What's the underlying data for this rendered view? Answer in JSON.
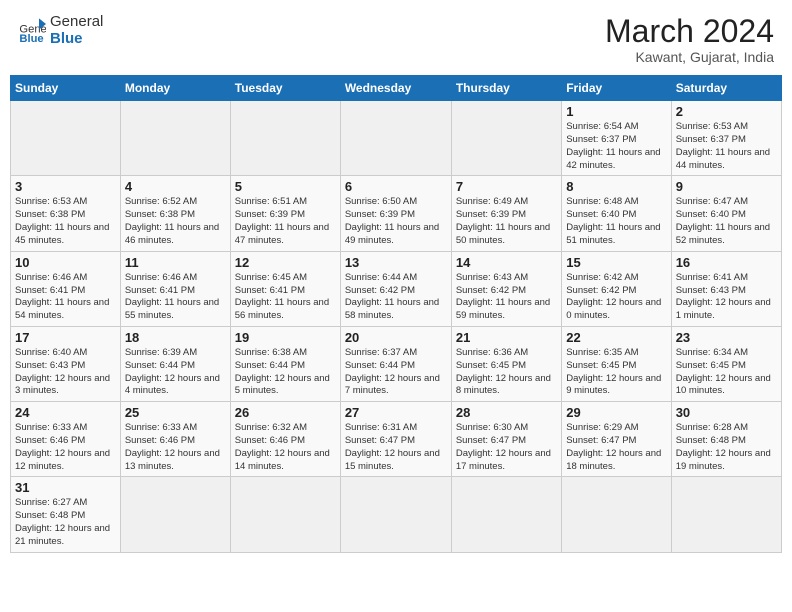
{
  "header": {
    "logo_text_general": "General",
    "logo_text_blue": "Blue",
    "month_title": "March 2024",
    "subtitle": "Kawant, Gujarat, India"
  },
  "weekdays": [
    "Sunday",
    "Monday",
    "Tuesday",
    "Wednesday",
    "Thursday",
    "Friday",
    "Saturday"
  ],
  "weeks": [
    [
      {
        "day": "",
        "info": ""
      },
      {
        "day": "",
        "info": ""
      },
      {
        "day": "",
        "info": ""
      },
      {
        "day": "",
        "info": ""
      },
      {
        "day": "",
        "info": ""
      },
      {
        "day": "1",
        "info": "Sunrise: 6:54 AM\nSunset: 6:37 PM\nDaylight: 11 hours\nand 42 minutes."
      },
      {
        "day": "2",
        "info": "Sunrise: 6:53 AM\nSunset: 6:37 PM\nDaylight: 11 hours\nand 44 minutes."
      }
    ],
    [
      {
        "day": "3",
        "info": "Sunrise: 6:53 AM\nSunset: 6:38 PM\nDaylight: 11 hours\nand 45 minutes."
      },
      {
        "day": "4",
        "info": "Sunrise: 6:52 AM\nSunset: 6:38 PM\nDaylight: 11 hours\nand 46 minutes."
      },
      {
        "day": "5",
        "info": "Sunrise: 6:51 AM\nSunset: 6:39 PM\nDaylight: 11 hours\nand 47 minutes."
      },
      {
        "day": "6",
        "info": "Sunrise: 6:50 AM\nSunset: 6:39 PM\nDaylight: 11 hours\nand 49 minutes."
      },
      {
        "day": "7",
        "info": "Sunrise: 6:49 AM\nSunset: 6:39 PM\nDaylight: 11 hours\nand 50 minutes."
      },
      {
        "day": "8",
        "info": "Sunrise: 6:48 AM\nSunset: 6:40 PM\nDaylight: 11 hours\nand 51 minutes."
      },
      {
        "day": "9",
        "info": "Sunrise: 6:47 AM\nSunset: 6:40 PM\nDaylight: 11 hours\nand 52 minutes."
      }
    ],
    [
      {
        "day": "10",
        "info": "Sunrise: 6:46 AM\nSunset: 6:41 PM\nDaylight: 11 hours\nand 54 minutes."
      },
      {
        "day": "11",
        "info": "Sunrise: 6:46 AM\nSunset: 6:41 PM\nDaylight: 11 hours\nand 55 minutes."
      },
      {
        "day": "12",
        "info": "Sunrise: 6:45 AM\nSunset: 6:41 PM\nDaylight: 11 hours\nand 56 minutes."
      },
      {
        "day": "13",
        "info": "Sunrise: 6:44 AM\nSunset: 6:42 PM\nDaylight: 11 hours\nand 58 minutes."
      },
      {
        "day": "14",
        "info": "Sunrise: 6:43 AM\nSunset: 6:42 PM\nDaylight: 11 hours\nand 59 minutes."
      },
      {
        "day": "15",
        "info": "Sunrise: 6:42 AM\nSunset: 6:42 PM\nDaylight: 12 hours\nand 0 minutes."
      },
      {
        "day": "16",
        "info": "Sunrise: 6:41 AM\nSunset: 6:43 PM\nDaylight: 12 hours\nand 1 minute."
      }
    ],
    [
      {
        "day": "17",
        "info": "Sunrise: 6:40 AM\nSunset: 6:43 PM\nDaylight: 12 hours\nand 3 minutes."
      },
      {
        "day": "18",
        "info": "Sunrise: 6:39 AM\nSunset: 6:44 PM\nDaylight: 12 hours\nand 4 minutes."
      },
      {
        "day": "19",
        "info": "Sunrise: 6:38 AM\nSunset: 6:44 PM\nDaylight: 12 hours\nand 5 minutes."
      },
      {
        "day": "20",
        "info": "Sunrise: 6:37 AM\nSunset: 6:44 PM\nDaylight: 12 hours\nand 7 minutes."
      },
      {
        "day": "21",
        "info": "Sunrise: 6:36 AM\nSunset: 6:45 PM\nDaylight: 12 hours\nand 8 minutes."
      },
      {
        "day": "22",
        "info": "Sunrise: 6:35 AM\nSunset: 6:45 PM\nDaylight: 12 hours\nand 9 minutes."
      },
      {
        "day": "23",
        "info": "Sunrise: 6:34 AM\nSunset: 6:45 PM\nDaylight: 12 hours\nand 10 minutes."
      }
    ],
    [
      {
        "day": "24",
        "info": "Sunrise: 6:33 AM\nSunset: 6:46 PM\nDaylight: 12 hours\nand 12 minutes."
      },
      {
        "day": "25",
        "info": "Sunrise: 6:33 AM\nSunset: 6:46 PM\nDaylight: 12 hours\nand 13 minutes."
      },
      {
        "day": "26",
        "info": "Sunrise: 6:32 AM\nSunset: 6:46 PM\nDaylight: 12 hours\nand 14 minutes."
      },
      {
        "day": "27",
        "info": "Sunrise: 6:31 AM\nSunset: 6:47 PM\nDaylight: 12 hours\nand 15 minutes."
      },
      {
        "day": "28",
        "info": "Sunrise: 6:30 AM\nSunset: 6:47 PM\nDaylight: 12 hours\nand 17 minutes."
      },
      {
        "day": "29",
        "info": "Sunrise: 6:29 AM\nSunset: 6:47 PM\nDaylight: 12 hours\nand 18 minutes."
      },
      {
        "day": "30",
        "info": "Sunrise: 6:28 AM\nSunset: 6:48 PM\nDaylight: 12 hours\nand 19 minutes."
      }
    ],
    [
      {
        "day": "31",
        "info": "Sunrise: 6:27 AM\nSunset: 6:48 PM\nDaylight: 12 hours\nand 21 minutes."
      },
      {
        "day": "",
        "info": ""
      },
      {
        "day": "",
        "info": ""
      },
      {
        "day": "",
        "info": ""
      },
      {
        "day": "",
        "info": ""
      },
      {
        "day": "",
        "info": ""
      },
      {
        "day": "",
        "info": ""
      }
    ]
  ]
}
